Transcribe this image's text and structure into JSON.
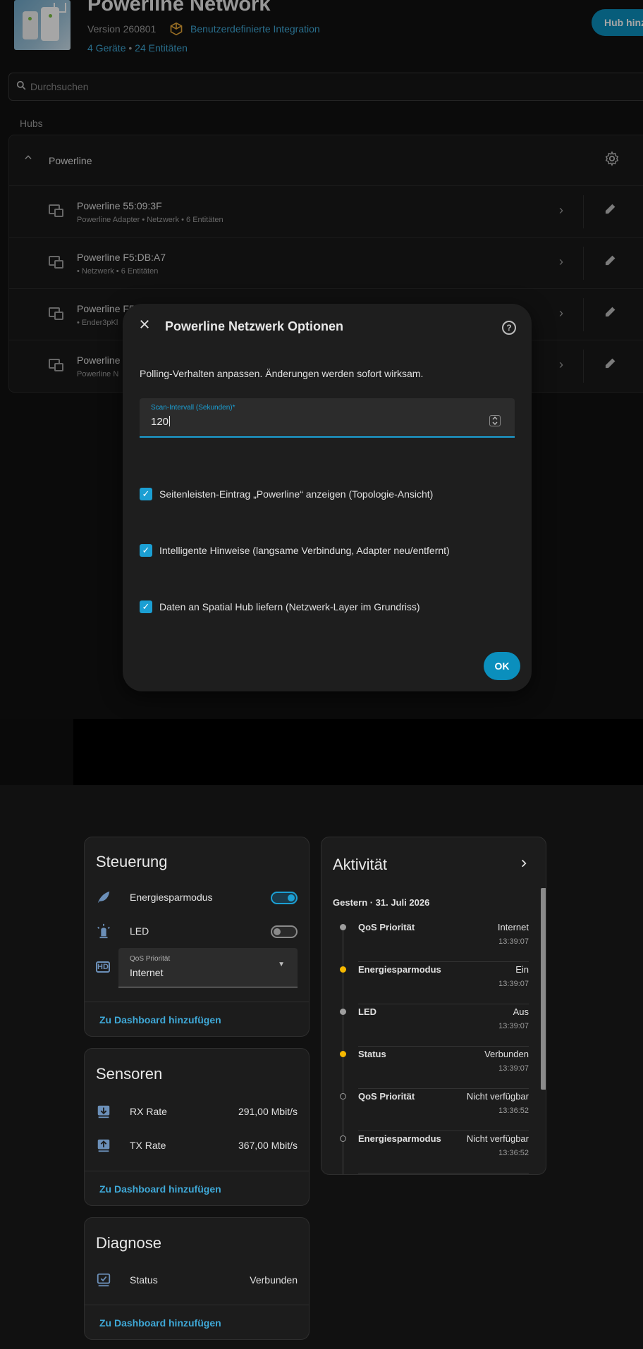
{
  "integration": {
    "title": "Powerline Network",
    "version": "Version 260801",
    "custom_label": "Benutzerdefinierte Integration",
    "devices_link": "4 Geräte",
    "separator": "•",
    "entities_link": "24 Entitäten",
    "hub_button": "Hub hinz"
  },
  "search": {
    "placeholder": "Durchsuchen"
  },
  "hubs": {
    "section_label": "Hubs",
    "hub_name": "Powerline",
    "devices": [
      {
        "name": "Powerline 55:09:3F",
        "sub": "Powerline Adapter • Netzwerk • 6 Entitäten"
      },
      {
        "name": "Powerline F5:DB:A7",
        "sub": " • Netzwerk • 6 Entitäten"
      },
      {
        "name": "Powerline F5",
        "sub": " • Ender3pKl"
      },
      {
        "name": "Powerline",
        "sub": "Powerline N"
      }
    ]
  },
  "dialog": {
    "title": "Powerline Netzwerk Optionen",
    "description": "Polling-Verhalten anpassen. Änderungen werden sofort wirksam.",
    "scan_field": {
      "label": "Scan-Intervall (Sekunden)*",
      "value": "120"
    },
    "checkboxes": [
      {
        "label": "Seitenleisten-Eintrag „Powerline“ anzeigen (Topologie-Ansicht)",
        "checked": true
      },
      {
        "label": "Intelligente Hinweise (langsame Verbindung, Adapter neu/entfernt)",
        "checked": true
      },
      {
        "label": "Daten an Spatial Hub liefern (Netzwerk-Layer im Grundriss)",
        "checked": true
      }
    ],
    "ok_label": "OK"
  },
  "steuerung": {
    "title": "Steuerung",
    "energy": {
      "label": "Energiesparmodus",
      "on": true
    },
    "led": {
      "label": "LED",
      "on": false
    },
    "qos": {
      "label": "QoS Priorität",
      "value": "Internet"
    },
    "footer": "Zu Dashboard hinzufügen"
  },
  "sensoren": {
    "title": "Sensoren",
    "rows": [
      {
        "label": "RX Rate",
        "value": "291,00 Mbit/s"
      },
      {
        "label": "TX Rate",
        "value": "367,00 Mbit/s"
      }
    ],
    "footer": "Zu Dashboard hinzufügen"
  },
  "diagnose": {
    "title": "Diagnose",
    "rows": [
      {
        "label": "Status",
        "value": "Verbunden"
      }
    ],
    "footer": "Zu Dashboard hinzufügen"
  },
  "activity": {
    "title": "Aktivität",
    "date": "Gestern · 31. Juli 2026",
    "items": [
      {
        "name": "QoS Priorität",
        "value": "Internet",
        "time": "13:39:07",
        "dot": "grey"
      },
      {
        "name": "Energiesparmodus",
        "value": "Ein",
        "time": "13:39:07",
        "dot": "yellow"
      },
      {
        "name": "LED",
        "value": "Aus",
        "time": "13:39:07",
        "dot": "grey"
      },
      {
        "name": "Status",
        "value": "Verbunden",
        "time": "13:39:07",
        "dot": "yellow"
      },
      {
        "name": "QoS Priorität",
        "value": "Nicht verfügbar",
        "time": "13:36:52",
        "dot": "hollow"
      },
      {
        "name": "Energiesparmodus",
        "value": "Nicht verfügbar",
        "time": "13:36:52",
        "dot": "hollow"
      }
    ]
  },
  "colors": {
    "accent": "#0b8fbd",
    "link": "#3fa9d8",
    "warning": "#f5b800"
  }
}
